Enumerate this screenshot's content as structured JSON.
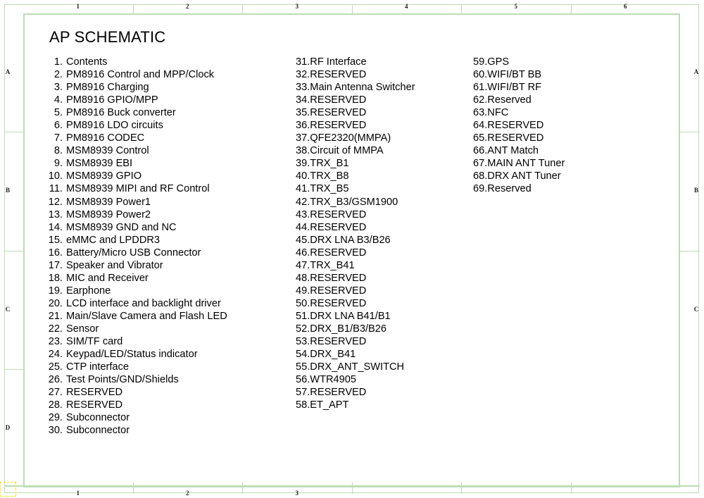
{
  "sheet": {
    "title": "AP SCHEMATIC",
    "border_color": "#bcdcb4",
    "selection_marker_color": "#ffe000",
    "text_color": "#000000"
  },
  "frame": {
    "columns_top": [
      "1",
      "2",
      "3",
      "4",
      "5",
      "6"
    ],
    "columns_bottom": [
      "1",
      "2",
      "3"
    ],
    "rows_left": [
      "A",
      "B",
      "C",
      "D"
    ],
    "rows_right": [
      "A",
      "B",
      "C"
    ]
  },
  "contents": {
    "column_1": [
      {
        "num": "1.",
        "text": "Contents"
      },
      {
        "num": "2.",
        "text": "PM8916 Control and MPP/Clock"
      },
      {
        "num": "3.",
        "text": "PM8916 Charging"
      },
      {
        "num": "4.",
        "text": "PM8916 GPIO/MPP"
      },
      {
        "num": "5.",
        "text": "PM8916 Buck converter"
      },
      {
        "num": "6.",
        "text": "PM8916 LDO circuits"
      },
      {
        "num": "7.",
        "text": "PM8916 CODEC"
      },
      {
        "num": "8.",
        "text": "MSM8939 Control"
      },
      {
        "num": "9.",
        "text": "MSM8939 EBI"
      },
      {
        "num": "10.",
        "text": "MSM8939 GPIO"
      },
      {
        "num": "11.",
        "text": "MSM8939 MIPI and RF Control"
      },
      {
        "num": "12.",
        "text": "MSM8939 Power1"
      },
      {
        "num": "13.",
        "text": "MSM8939 Power2"
      },
      {
        "num": "14.",
        "text": "MSM8939 GND and NC"
      },
      {
        "num": "15.",
        "text": "eMMC and LPDDR3"
      },
      {
        "num": "16.",
        "text": "Battery/Micro USB Connector"
      },
      {
        "num": "17.",
        "text": "Speaker and Vibrator"
      },
      {
        "num": "18.",
        "text": "MIC and Receiver"
      },
      {
        "num": "19.",
        "text": "Earphone"
      },
      {
        "num": "20.",
        "text": "LCD interface and backlight driver"
      },
      {
        "num": "21.",
        "text": "Main/Slave Camera and Flash LED"
      },
      {
        "num": "22.",
        "text": "Sensor"
      },
      {
        "num": "23.",
        "text": "SIM/TF card"
      },
      {
        "num": "24.",
        "text": "Keypad/LED/Status indicator"
      },
      {
        "num": "25.",
        "text": "CTP interface"
      },
      {
        "num": "26.",
        "text": "Test Points/GND/Shields"
      },
      {
        "num": "27.",
        "text": "RESERVED"
      },
      {
        "num": "28.",
        "text": "RESERVED"
      },
      {
        "num": "29.",
        "text": "Subconnector"
      },
      {
        "num": "30.",
        "text": "Subconnector"
      }
    ],
    "column_2": [
      {
        "num": "31.",
        "text": "RF Interface"
      },
      {
        "num": "32.",
        "text": "RESERVED"
      },
      {
        "num": "33.",
        "text": "Main Antenna Switcher"
      },
      {
        "num": "34.",
        "text": "RESERVED"
      },
      {
        "num": "35.",
        "text": "RESERVED"
      },
      {
        "num": "36.",
        "text": "RESERVED"
      },
      {
        "num": "37.",
        "text": "QFE2320(MMPA)"
      },
      {
        "num": "38.",
        "text": "Circuit of MMPA"
      },
      {
        "num": "39.",
        "text": "TRX_B1"
      },
      {
        "num": "40.",
        "text": "TRX_B8"
      },
      {
        "num": "41.",
        "text": "TRX_B5"
      },
      {
        "num": "42.",
        "text": "TRX_B3/GSM1900"
      },
      {
        "num": "43.",
        "text": "RESERVED"
      },
      {
        "num": "44.",
        "text": "RESERVED"
      },
      {
        "num": "45.",
        "text": "DRX LNA B3/B26"
      },
      {
        "num": "46.",
        "text": "RESERVED"
      },
      {
        "num": "47.",
        "text": "TRX_B41"
      },
      {
        "num": "48.",
        "text": "RESERVED"
      },
      {
        "num": "49.",
        "text": "RESERVED"
      },
      {
        "num": "50.",
        "text": "RESERVED"
      },
      {
        "num": "51.",
        "text": "DRX LNA B41/B1"
      },
      {
        "num": "52.",
        "text": "DRX_B1/B3/B26"
      },
      {
        "num": "53.",
        "text": "RESERVED"
      },
      {
        "num": "54.",
        "text": "DRX_B41"
      },
      {
        "num": "55.",
        "text": "DRX_ANT_SWITCH"
      },
      {
        "num": "56.",
        "text": "WTR4905"
      },
      {
        "num": "57.",
        "text": "RESERVED"
      },
      {
        "num": "58.",
        "text": "ET_APT"
      }
    ],
    "column_3": [
      {
        "num": "59.",
        "text": "GPS"
      },
      {
        "num": "60.",
        "text": "WIFI/BT BB"
      },
      {
        "num": "61.",
        "text": "WIFI/BT RF"
      },
      {
        "num": "62.",
        "text": "Reserved"
      },
      {
        "num": "63.",
        "text": "NFC"
      },
      {
        "num": "64.",
        "text": "RESERVED"
      },
      {
        "num": "65.",
        "text": "RESERVED"
      },
      {
        "num": "66.",
        "text": "ANT Match"
      },
      {
        "num": "67.",
        "text": "MAIN ANT Tuner"
      },
      {
        "num": "68.",
        "text": "DRX ANT Tuner"
      },
      {
        "num": "69.",
        "text": "Reserved"
      }
    ]
  }
}
